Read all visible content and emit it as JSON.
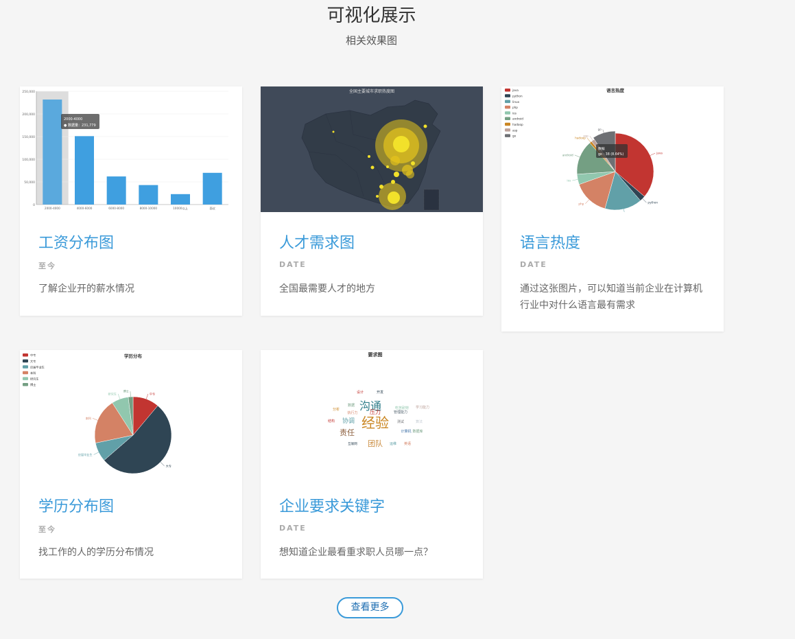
{
  "header": {
    "title": "可视化展示",
    "subtitle": "相关效果图"
  },
  "colors": {
    "accent": "#3a9ad9",
    "bar": "#3f9fe0",
    "map_bg": "#404a59",
    "bubble": "#e6c51c"
  },
  "cards": [
    {
      "title": "工资分布图",
      "date": "至今",
      "desc": "了解企业开的薪水情况",
      "thumb": {
        "kind": "bar-chart",
        "tooltip": {
          "line1": "2000-4000",
          "line2": "● 数据量：231,779"
        }
      }
    },
    {
      "title": "人才需求图",
      "date": "DATE",
      "desc": "全国最需要人才的地方",
      "thumb": {
        "kind": "map",
        "title": "全国主要城市求职热度图"
      }
    },
    {
      "title": "语言热度",
      "date": "DATE",
      "desc": "通过这张图片，可以知道当前企业在计算机行业中对什么语言最有需求",
      "thumb": {
        "kind": "pie-chart",
        "title": "语言热度",
        "tooltip": {
          "line1": "数据",
          "line2": "go : 38 (8.64%)"
        }
      }
    },
    {
      "title": "学历分布图",
      "date": "至今",
      "desc": "找工作的人的学历分布情况",
      "thumb": {
        "kind": "pie-chart",
        "title": "学历分布"
      }
    },
    {
      "title": "企业要求关键字",
      "date": "DATE",
      "desc": "想知道企业最看重求职人员哪一点？",
      "thumb": {
        "kind": "word-cloud",
        "title": "要求图",
        "words": [
          {
            "t": "设计",
            "c": "#c23531"
          },
          {
            "t": "开发",
            "c": "#2f4554"
          },
          {
            "t": "团队",
            "c": "#c98a3c"
          },
          {
            "t": "沟通",
            "c": "#2f7e8a"
          },
          {
            "t": "数据",
            "c": "#749f83"
          },
          {
            "t": "经验",
            "c": "#ca8622"
          },
          {
            "t": "责任",
            "c": "#8b5e3c"
          },
          {
            "t": "协调",
            "c": "#61a0a8"
          },
          {
            "t": "压力",
            "c": "#c23531"
          },
          {
            "t": "吃苦耐劳",
            "c": "#91c7ae"
          },
          {
            "t": "管理能力",
            "c": "#546570"
          },
          {
            "t": "测试",
            "c": "#6e7074"
          },
          {
            "t": "算法",
            "c": "#c4ccd3"
          },
          {
            "t": "学习能力",
            "c": "#bda29a"
          },
          {
            "t": "执行力",
            "c": "#d48265"
          },
          {
            "t": "计算机",
            "c": "#3a6ea5"
          },
          {
            "t": "数据库",
            "c": "#749f83"
          },
          {
            "t": "分析",
            "c": "#ca8622"
          },
          {
            "t": "结构",
            "c": "#c23531"
          },
          {
            "t": "互联网",
            "c": "#2f4554"
          },
          {
            "t": "运维",
            "c": "#61a0a8"
          },
          {
            "t": "英语",
            "c": "#d48265"
          }
        ]
      }
    }
  ],
  "chart_data": [
    {
      "type": "bar",
      "categories": [
        "2000-4000",
        "4000-6000",
        "6000-8000",
        "8000-10000",
        "10000以上",
        "面议"
      ],
      "values": [
        231779,
        151000,
        62000,
        43000,
        23000,
        70000
      ],
      "ylim": [
        0,
        250000
      ],
      "yticks": [
        "0",
        "50,000",
        "100,000",
        "150,000",
        "200,000",
        "250,000"
      ],
      "grid": true
    },
    {
      "type": "pie",
      "title": "语言热度",
      "legend": "top-left",
      "series": [
        {
          "name": "java",
          "value": 150,
          "color": "#c23531"
        },
        {
          "name": "python",
          "value": 10,
          "color": "#2f4554"
        },
        {
          "name": "linux",
          "value": 65,
          "color": "#61a0a8"
        },
        {
          "name": "php",
          "value": 63,
          "color": "#d48265"
        },
        {
          "name": "ios",
          "value": 18,
          "color": "#91c7ae"
        },
        {
          "name": "android",
          "value": 60,
          "color": "#749f83"
        },
        {
          "name": "hadoop",
          "value": 4,
          "color": "#ca8622"
        },
        {
          "name": "asp",
          "value": 6,
          "color": "#bda29a"
        },
        {
          "name": "go",
          "value": 38,
          "color": "#6e7074"
        }
      ]
    },
    {
      "type": "pie",
      "title": "学历分布",
      "legend": "top-left",
      "series": [
        {
          "name": "中专",
          "value": 11,
          "color": "#c23531"
        },
        {
          "name": "大专",
          "value": 52,
          "color": "#2f4554"
        },
        {
          "name": "应届毕业生",
          "value": 8,
          "color": "#61a0a8"
        },
        {
          "name": "本科",
          "value": 19,
          "color": "#d48265"
        },
        {
          "name": "研究生",
          "value": 7,
          "color": "#91c7ae"
        },
        {
          "name": "博士",
          "value": 2,
          "color": "#749f83"
        }
      ]
    }
  ],
  "more_button": "查看更多"
}
